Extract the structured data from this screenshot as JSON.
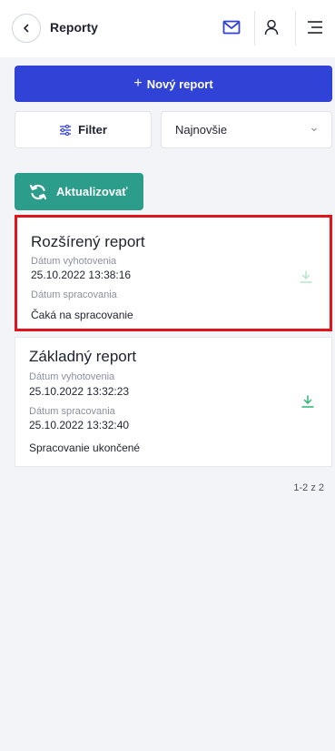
{
  "header": {
    "title": "Reporty"
  },
  "actions": {
    "new_report_label": "Nový report",
    "filter_label": "Filter",
    "sort_value": "Najnovšie",
    "refresh_label": "Aktualizovať"
  },
  "reports": [
    {
      "title": "Rozšírený report",
      "created_label": "Dátum vyhotovenia",
      "created": "25.10.2022 13:38:16",
      "processed_label": "Dátum spracovania",
      "processed": "",
      "status": "Čaká na spracovanie"
    },
    {
      "title": "Základný report",
      "created_label": "Dátum vyhotovenia",
      "created": "25.10.2022 13:32:23",
      "processed_label": "Dátum spracovania",
      "processed": "25.10.2022 13:32:40",
      "status": "Spracovanie ukončené"
    }
  ],
  "pagination": {
    "text": "1-2 z 2"
  },
  "colors": {
    "primary": "#3142d6",
    "accent": "#2b9d8a",
    "highlight": "#e0151b",
    "download_active": "#2bb673",
    "download_disabled": "#b6e6cc"
  }
}
